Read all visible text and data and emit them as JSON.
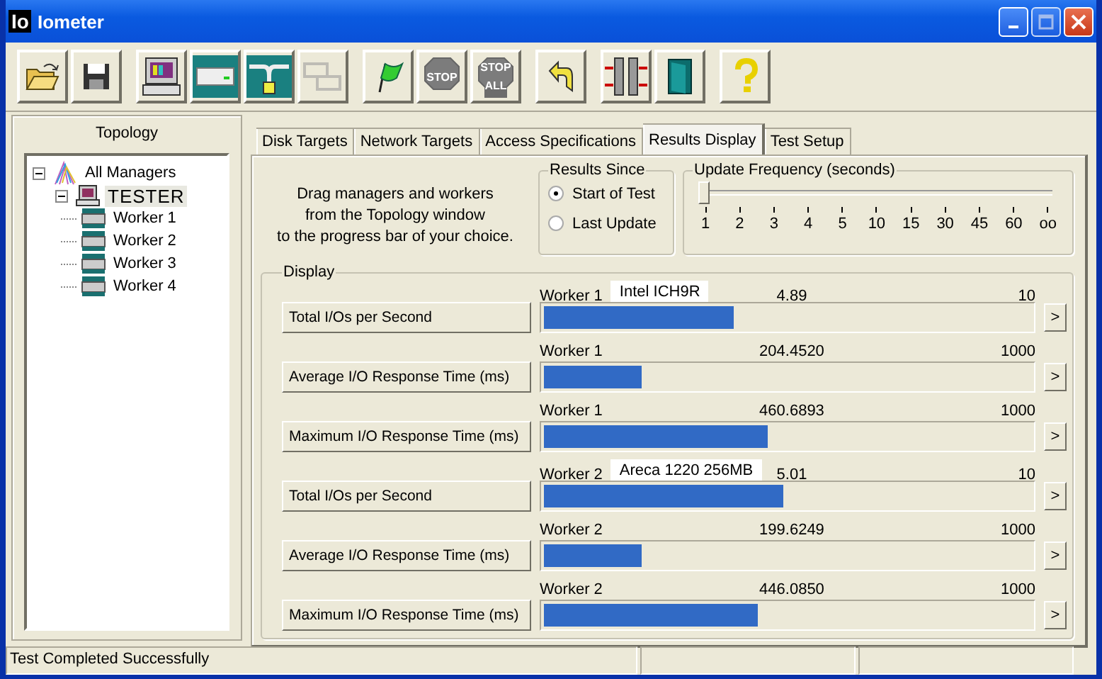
{
  "window": {
    "logo": "Io",
    "title": "Iometer"
  },
  "toolbar": {
    "groups": [
      [
        {
          "disabled": false
        },
        {
          "disabled": false
        }
      ],
      [
        {
          "disabled": false
        },
        {
          "disabled": false
        },
        {
          "disabled": false
        },
        {
          "disabled": true
        }
      ],
      [
        {
          "disabled": false
        },
        {
          "disabled": true,
          "text": [
            "STOP"
          ]
        },
        {
          "disabled": true,
          "text": [
            "STOP",
            "ALL"
          ]
        }
      ],
      [
        {
          "disabled": false
        }
      ],
      [
        {
          "disabled": false
        },
        {
          "disabled": false
        }
      ],
      [
        {
          "disabled": false
        }
      ]
    ]
  },
  "topology": {
    "title": "Topology",
    "tree": [
      {
        "label": "All Managers",
        "kind": "all",
        "expanded": true,
        "selected": false,
        "children": [
          {
            "label": "TESTER",
            "kind": "manager",
            "expanded": true,
            "selected": true,
            "children": [
              {
                "label": "Worker 1",
                "kind": "worker",
                "selected": false
              },
              {
                "label": "Worker 2",
                "kind": "worker",
                "selected": false
              },
              {
                "label": "Worker 3",
                "kind": "worker",
                "selected": false
              },
              {
                "label": "Worker 4",
                "kind": "worker",
                "selected": false
              }
            ]
          }
        ]
      }
    ]
  },
  "tabs": [
    {
      "label": "Disk Targets",
      "selected": false
    },
    {
      "label": "Network Targets",
      "selected": false
    },
    {
      "label": "Access Specifications",
      "selected": false
    },
    {
      "label": "Results Display",
      "selected": true
    },
    {
      "label": "Test Setup",
      "selected": false
    }
  ],
  "results_display": {
    "instructions": [
      "Drag managers and workers",
      "from the Topology window",
      "to the progress bar of your choice."
    ],
    "results_since": {
      "title": "Results Since",
      "options": [
        {
          "label": "Start of Test",
          "selected": true
        },
        {
          "label": "Last Update",
          "selected": false
        }
      ]
    },
    "update_frequency": {
      "title": "Update Frequency (seconds)",
      "level": 0,
      "ticks": [
        "1",
        "2",
        "3",
        "4",
        "5",
        "10",
        "15",
        "30",
        "45",
        "60",
        "oo"
      ]
    },
    "display": {
      "title": "Display",
      "rows": [
        {
          "metric": "Total I/Os per Second",
          "worker": "Worker 1",
          "target": "Intel ICH9R",
          "value": "4.89",
          "max": "10",
          "level": 0.39,
          "arrow": ">"
        },
        {
          "metric": "Average I/O Response Time (ms)",
          "worker": "Worker 1",
          "value": "204.4520",
          "max": "1000",
          "level": 0.2,
          "arrow": ">"
        },
        {
          "metric": "Maximum I/O Response Time (ms)",
          "worker": "Worker 1",
          "value": "460.6893",
          "max": "1000",
          "level": 0.46,
          "arrow": ">"
        },
        {
          "metric": "Total I/Os per Second",
          "worker": "Worker 2",
          "target": "Areca 1220 256MB",
          "value": "5.01",
          "max": "10",
          "level": 0.49,
          "arrow": ">"
        },
        {
          "metric": "Average I/O Response Time (ms)",
          "worker": "Worker 2",
          "value": "199.6249",
          "max": "1000",
          "level": 0.2,
          "arrow": ">"
        },
        {
          "metric": "Maximum I/O Response Time (ms)",
          "worker": "Worker 2",
          "value": "446.0850",
          "max": "1000",
          "level": 0.44,
          "arrow": ">"
        }
      ]
    }
  },
  "status_bar": {
    "message": "Test Completed Successfully"
  }
}
